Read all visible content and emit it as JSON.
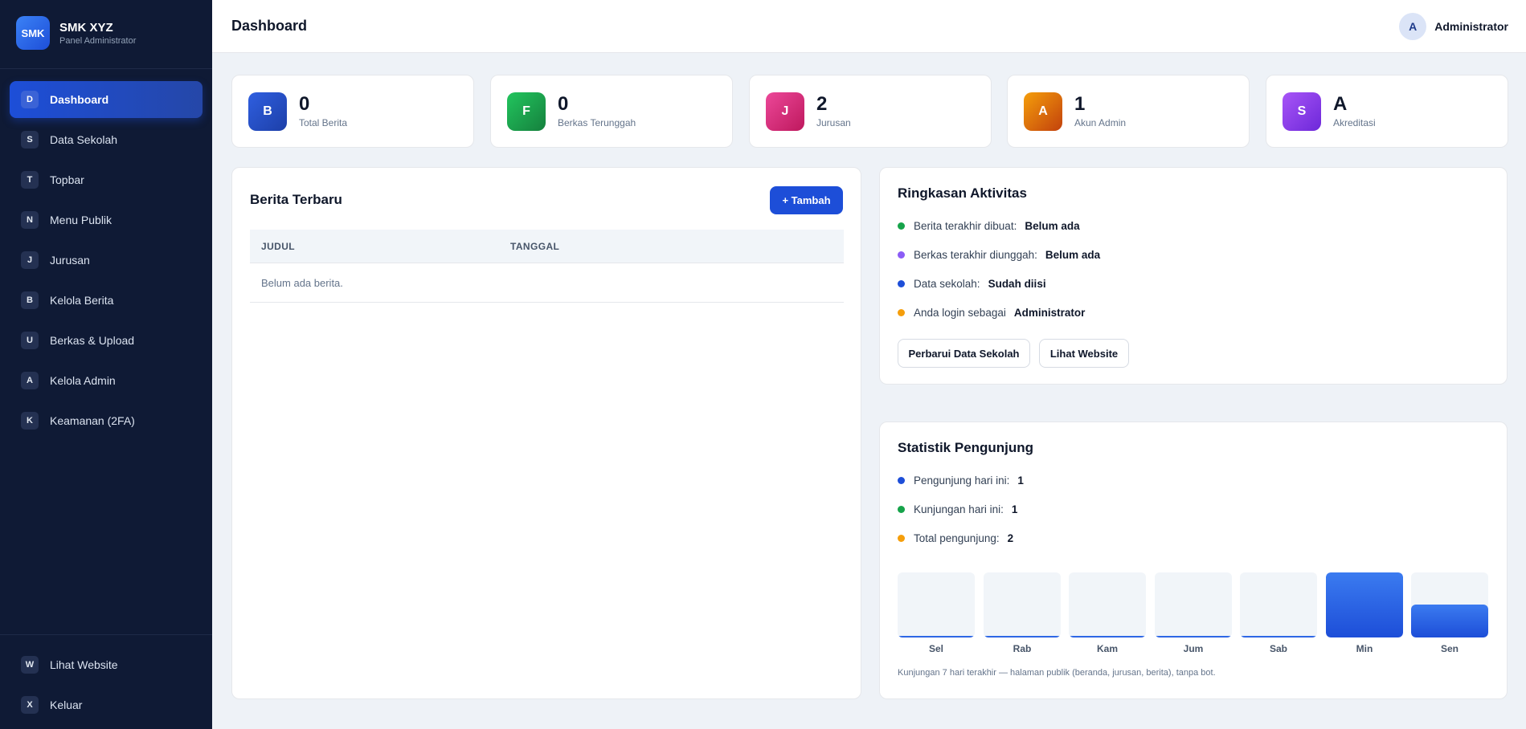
{
  "brand": {
    "logo": "SMK",
    "name": "SMK XYZ",
    "subtitle": "Panel Administrator",
    "color": "#2563eb"
  },
  "sidebar": {
    "items": [
      {
        "badge": "D",
        "label": "Dashboard",
        "active": true
      },
      {
        "badge": "S",
        "label": "Data Sekolah"
      },
      {
        "badge": "T",
        "label": "Topbar"
      },
      {
        "badge": "N",
        "label": "Menu Publik"
      },
      {
        "badge": "J",
        "label": "Jurusan"
      },
      {
        "badge": "B",
        "label": "Kelola Berita"
      },
      {
        "badge": "U",
        "label": "Berkas & Upload"
      },
      {
        "badge": "A",
        "label": "Kelola Admin"
      },
      {
        "badge": "K",
        "label": "Keamanan (2FA)"
      }
    ],
    "bottom_items": [
      {
        "badge": "W",
        "label": "Lihat Website"
      },
      {
        "badge": "X",
        "label": "Keluar"
      }
    ]
  },
  "header": {
    "title": "Dashboard",
    "user_initial": "A",
    "user_name": "Administrator"
  },
  "stats": [
    {
      "icon": "B",
      "value": "0",
      "label": "Total Berita",
      "color": "#1d4ed8"
    },
    {
      "icon": "F",
      "value": "0",
      "label": "Berkas Terunggah",
      "color": "#16a34a"
    },
    {
      "icon": "J",
      "value": "2",
      "label": "Jurusan",
      "color": "#db2777"
    },
    {
      "icon": "A",
      "value": "1",
      "label": "Akun Admin",
      "color": "#d97706"
    },
    {
      "icon": "S",
      "value": "A",
      "label": "Akreditasi",
      "color": "#7c3aed"
    }
  ],
  "news": {
    "title": "Berita Terbaru",
    "add_label": "+ Tambah",
    "columns": [
      "JUDUL",
      "TANGGAL"
    ],
    "empty_text": "Belum ada berita."
  },
  "activity": {
    "title": "Ringkasan Aktivitas",
    "items": [
      {
        "label": "Berita terakhir dibuat:",
        "value": "Belum ada",
        "color": "#16a34a"
      },
      {
        "label": "Berkas terakhir diunggah:",
        "value": "Belum ada",
        "color": "#8b5cf6"
      },
      {
        "label": "Data sekolah:",
        "value": "Sudah diisi",
        "color": "#1d4ed8"
      },
      {
        "label": "Anda login sebagai",
        "value": "Administrator",
        "color": "#f59e0b"
      }
    ],
    "update_button": "Perbarui Data Sekolah",
    "view_button": "Lihat Website"
  },
  "visitors": {
    "title": "Statistik Pengunjung",
    "items": [
      {
        "label": "Pengunjung hari ini:",
        "value": "1",
        "color": "#1d4ed8"
      },
      {
        "label": "Kunjungan hari ini:",
        "value": "1",
        "color": "#16a34a"
      },
      {
        "label": "Total pengunjung:",
        "value": "2",
        "color": "#f59e0b"
      }
    ],
    "chart_data": {
      "type": "bar",
      "categories": [
        "Sel",
        "Rab",
        "Kam",
        "Jum",
        "Sab",
        "Min",
        "Sen"
      ],
      "values": [
        0,
        0,
        0,
        0,
        0,
        2,
        1
      ],
      "ylim": [
        0,
        2
      ]
    },
    "note": "Kunjungan 7 hari terakhir — halaman publik (beranda, jurusan, berita), tanpa bot."
  }
}
